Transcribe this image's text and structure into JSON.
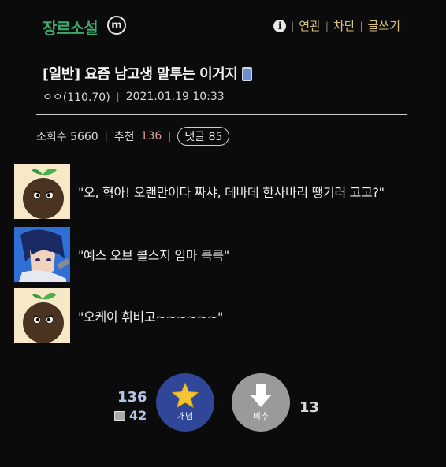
{
  "header": {
    "gallery_title": "장르소설",
    "minor_badge": "m",
    "links": [
      "연관",
      "차단",
      "글쓰기"
    ]
  },
  "post": {
    "title": "[일반] 요즘 남고생 말투는 이거지",
    "author": "ㅇㅇ(110.70)",
    "datetime": "2021.01.19 10:33"
  },
  "stats": {
    "views_label": "조회수 5660",
    "recommend_label": "추천",
    "recommend_count": "136",
    "comments_label": "댓글 85"
  },
  "dialogue": [
    {
      "avatar": "sprout-avatar",
      "text": "\"오, 혁아! 오랜만이다 짜샤, 데바데  한사바리 땡기러 고고?\""
    },
    {
      "avatar": "anime-avatar",
      "text": "\"예스 오브 콜스지 임마 큭큭\""
    },
    {
      "avatar": "sprout-avatar",
      "text": "\"오케이 휘비고~~~~~~\""
    }
  ],
  "votes": {
    "up_count": "136",
    "fixed_count": "42",
    "up_label": "개념",
    "down_label": "비추",
    "down_count": "13"
  },
  "colors": {
    "gallery_title": "#3fa86b",
    "header_links": "#d9c27a",
    "up_button": "#2f4699",
    "down_button": "#9a9a9a"
  }
}
